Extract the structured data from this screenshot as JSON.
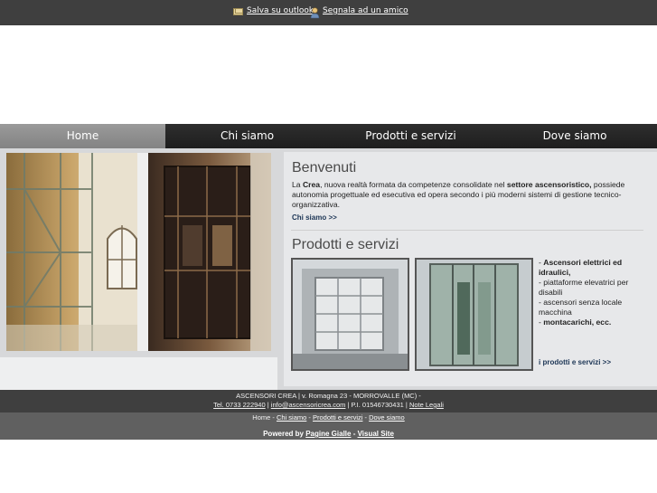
{
  "topbar": {
    "save_outlook": "Salva su outlook",
    "tell_friend": "Segnala ad un amico"
  },
  "nav": {
    "items": [
      {
        "label": "Home",
        "active": true
      },
      {
        "label": "Chi siamo",
        "active": false
      },
      {
        "label": "Prodotti e servizi",
        "active": false
      },
      {
        "label": "Dove siamo",
        "active": false
      }
    ]
  },
  "welcome": {
    "title": "Benvenuti",
    "text_1": "La ",
    "text_company": "Crea",
    "text_2": ", nuova realtà formata da competenze consolidate nel ",
    "text_sector": "settore ascensoristico,",
    "text_3": " possiede autonomia progettuale ed esecutiva ed opera secondo i più moderni sistemi di gestione tecnico-organizzativa.",
    "more": "Chi siamo >>"
  },
  "products": {
    "title": "Prodotti e servizi",
    "item1_prefix": " - ",
    "item1": "Ascensori elettrici ed idraulici,",
    "item2": "- piattaforme elevatrici per disabili",
    "item3": "- ascensori senza locale macchina",
    "item4_prefix": "- ",
    "item4": "montacarichi, ecc.",
    "more": "i prodotti e servizi >>"
  },
  "footer": {
    "line1": "ASCENSORI CREA | v. Romagna 23 - MORROVALLE (MC) -",
    "phone": "Tel. 0733 222940",
    "sep1": " | ",
    "email": "info@ascensoricrea.com",
    "piva": " | P.I. 01546730431 | ",
    "legal": "Note Legali",
    "nav_home": "Home",
    "nav_sep": " - ",
    "nav_chi": "Chi siamo",
    "nav_prod": "Prodotti e servizi",
    "nav_dove": "Dove siamo",
    "powered_label": "Powered by ",
    "powered_pg": "Pagine Gialle",
    "powered_dash": " - ",
    "powered_vs": "Visual Site"
  },
  "colors": {
    "topbar": "#3f3f3f",
    "nav_bg": "#262626",
    "nav_active": "#8e8e8e",
    "content_bg": "#d7d8da",
    "link": "#1c3555"
  }
}
